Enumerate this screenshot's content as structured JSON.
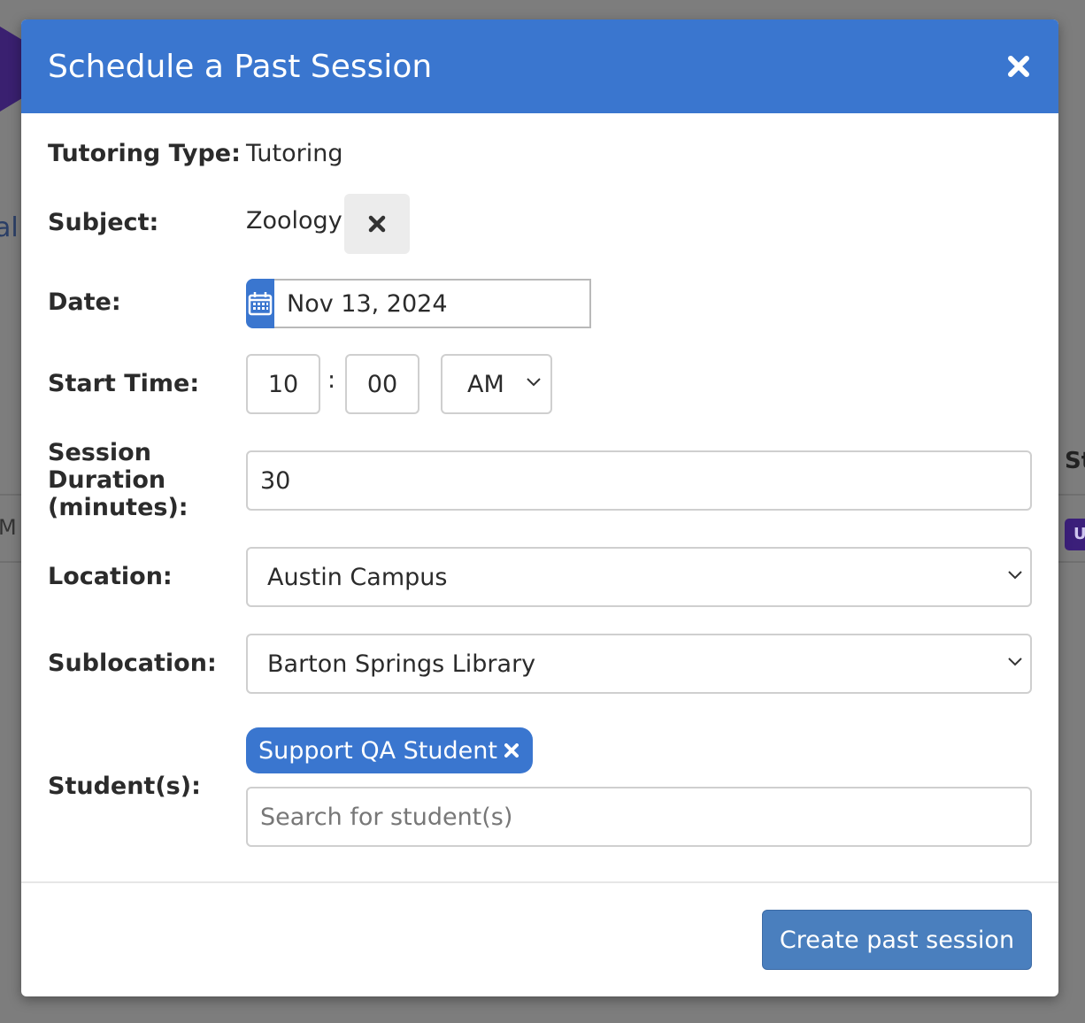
{
  "background": {
    "fragment_a": "al",
    "fragment_b": "M",
    "fragment_st": "St",
    "fragment_badge": "U"
  },
  "modal": {
    "title": "Schedule a Past Session",
    "close_icon": "close-icon",
    "tutoring_type": {
      "label": "Tutoring Type:",
      "value": "Tutoring"
    },
    "subject": {
      "label": "Subject:",
      "value": "Zoology",
      "clear_icon": "close-icon"
    },
    "date": {
      "label": "Date:",
      "value": "Nov 13, 2024",
      "icon": "calendar-icon"
    },
    "start_time": {
      "label": "Start Time:",
      "hour": "10",
      "separator": ":",
      "minute": "00",
      "period": "AM"
    },
    "duration": {
      "label_line1": "Session",
      "label_line2": "Duration",
      "label_line3": "(minutes):",
      "value": "30"
    },
    "location": {
      "label": "Location:",
      "value": "Austin Campus"
    },
    "sublocation": {
      "label": "Sublocation:",
      "value": "Barton Springs Library"
    },
    "students": {
      "label": "Student(s):",
      "selected": [
        {
          "name": "Support QA Student"
        }
      ],
      "search_placeholder": "Search for student(s)"
    },
    "create_button": "Create past session"
  },
  "colors": {
    "header_bg": "#3a76cf",
    "primary_button": "#4a7fbe",
    "tag_bg": "#3a76cf"
  }
}
